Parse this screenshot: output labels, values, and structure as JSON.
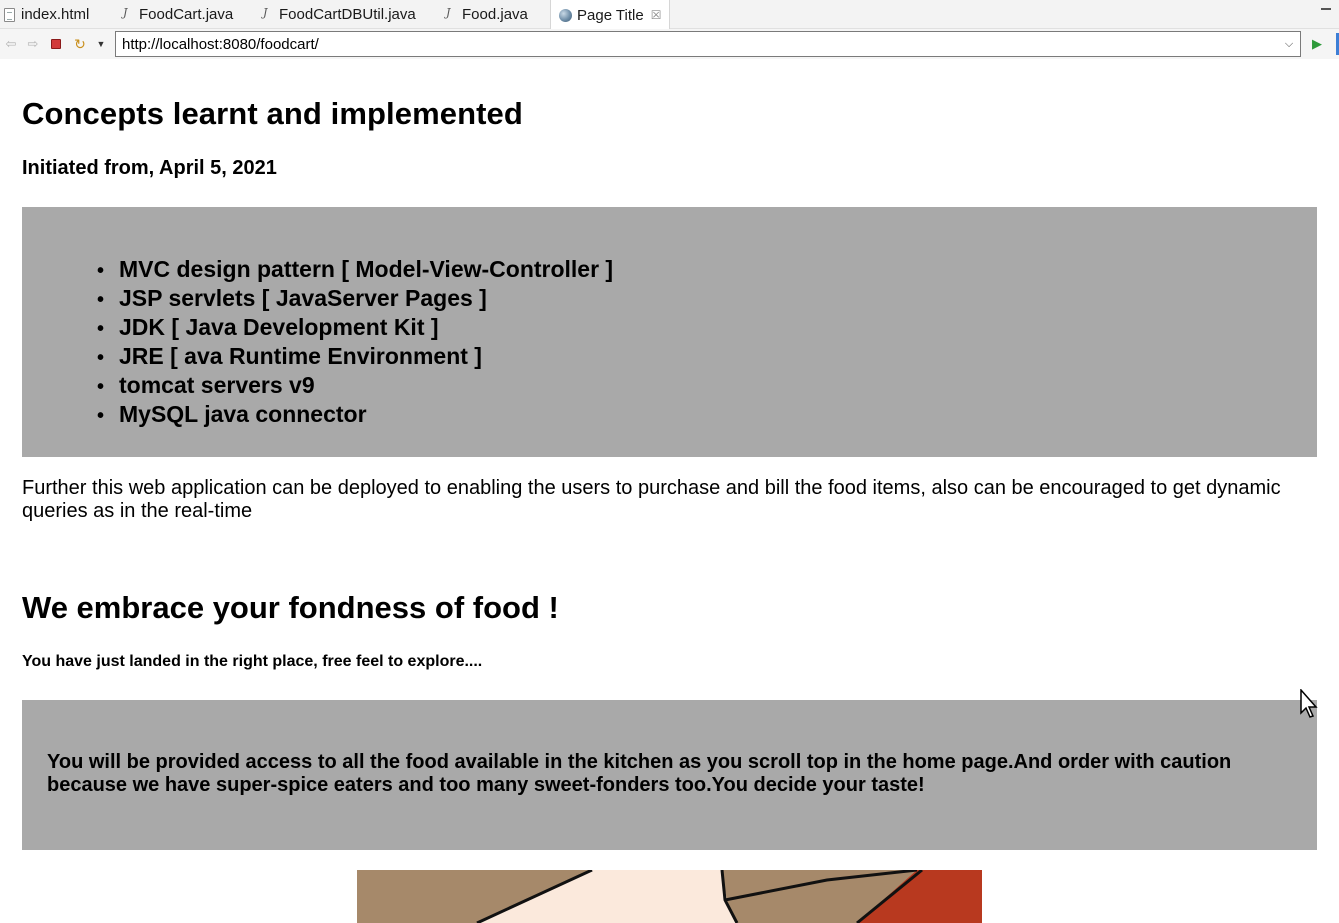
{
  "editor_tabs": [
    {
      "label": "index.html",
      "icon": "html-file-icon"
    },
    {
      "label": "FoodCart.java",
      "icon": "java-file-icon"
    },
    {
      "label": "FoodCartDBUtil.java",
      "icon": "java-file-icon"
    },
    {
      "label": "Food.java",
      "icon": "java-file-icon"
    },
    {
      "label": "Page Title",
      "icon": "globe-icon",
      "active": true
    }
  ],
  "address_bar": {
    "url": "http://localhost:8080/foodcart/"
  },
  "page": {
    "heading": "Concepts learnt and implemented",
    "subheading": "Initiated from, April 5, 2021",
    "concepts": [
      "MVC design pattern [ Model-View-Controller ]",
      "JSP servlets [ JavaServer Pages ]",
      "JDK [ Java Development Kit ]",
      "JRE [ ava Runtime Environment ]",
      "tomcat servers v9",
      "MySQL java connector"
    ],
    "paragraph": "Further this web application can be deployed to enabling the users to purchase and bill the food items, also can be encouraged to get dynamic queries as in the real-time",
    "heading2": "We embrace your fondness of food !",
    "subheading2": "You have just landed in the right place, free feel to explore....",
    "notice": "You will be provided access to all the food available in the kitchen as you scroll top in the home page.And order with caution because we have super-spice eaters and too many sweet-fonders too.You decide your taste!"
  },
  "colors": {
    "content_box": "#a9a9a9",
    "stop_button": "#d23a3a",
    "go_button": "#2e9a3a"
  }
}
